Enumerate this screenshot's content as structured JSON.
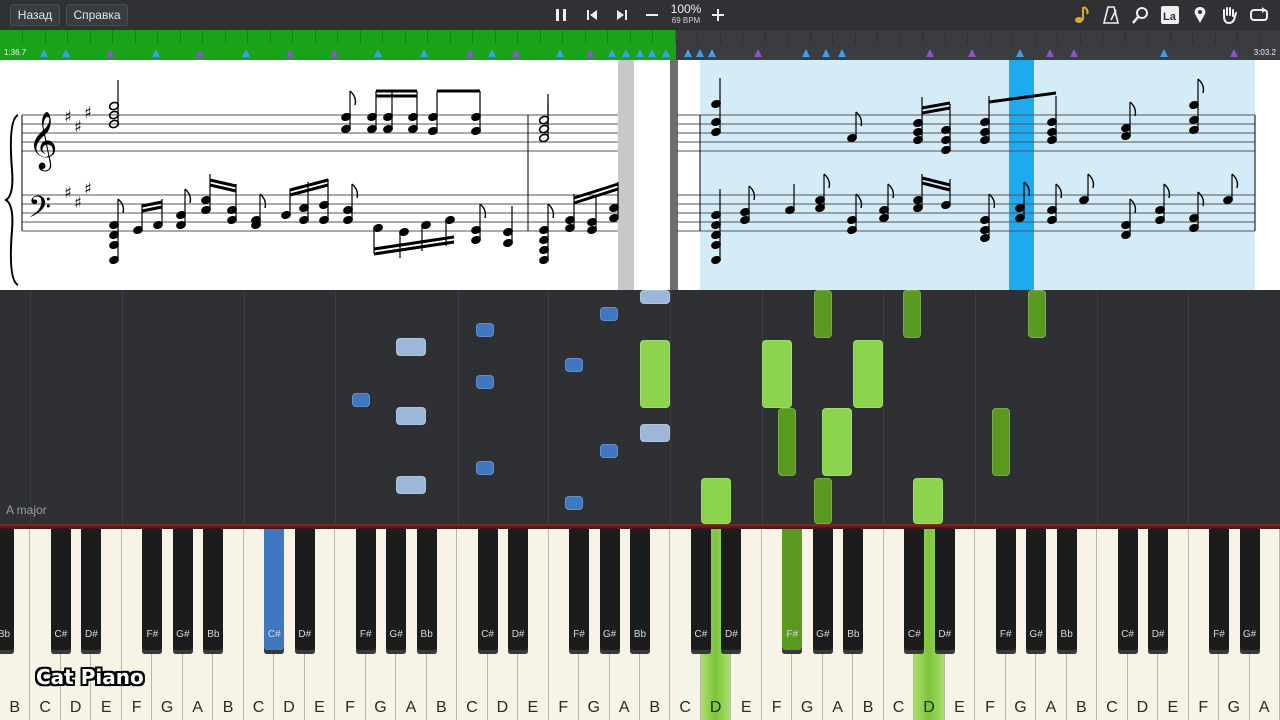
{
  "toolbar": {
    "back_label": "Назад",
    "help_label": "Справка",
    "speed_percent": "100%",
    "tempo": "69 BPM"
  },
  "timeline": {
    "elapsed": "1:36.7",
    "total": "3:03.2",
    "progress": 0.528
  },
  "roll": {
    "key_signature": "A major",
    "colors": {
      "left_hand": "#3f78c0",
      "left_hand_light": "#9cb8d8",
      "right_hand": "#8cd34e",
      "right_hand_dark": "#5a9a20"
    }
  },
  "keyboard": {
    "white_keys": [
      "B",
      "C",
      "D",
      "E",
      "F",
      "G",
      "A",
      "B",
      "C",
      "D",
      "E",
      "F",
      "G",
      "A",
      "B",
      "C",
      "D",
      "E",
      "F",
      "G",
      "A",
      "B",
      "C",
      "D",
      "E",
      "F",
      "G",
      "A",
      "B",
      "C",
      "D",
      "E",
      "F",
      "G",
      "A",
      "B",
      "C",
      "D",
      "E",
      "F",
      "G",
      "A"
    ],
    "black_keys": [
      "Bb",
      "C#",
      "D#",
      "F#",
      "G#",
      "Bb",
      "C#",
      "D#",
      "F#",
      "G#",
      "Bb",
      "C#",
      "D#",
      "F#",
      "G#",
      "Bb",
      "C#",
      "D#",
      "F#",
      "G#",
      "Bb",
      "C#",
      "D#",
      "F#",
      "G#",
      "Bb",
      "C#",
      "D#",
      "F#",
      "G#"
    ],
    "pressed": [
      "C#",
      "D",
      "G#",
      "D"
    ]
  },
  "watermark": "Cat Piano"
}
